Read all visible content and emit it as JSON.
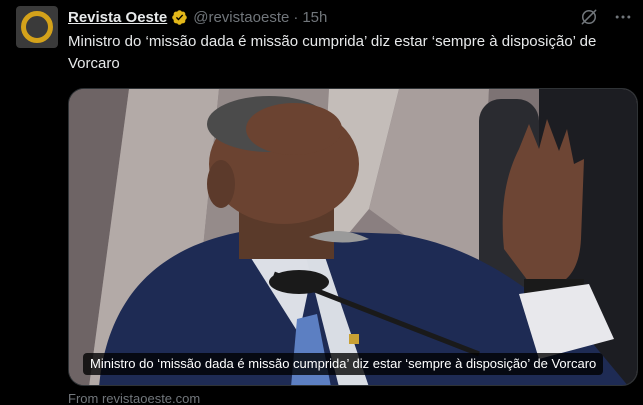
{
  "author": {
    "name": "Revista Oeste",
    "handle": "@revistaoeste",
    "separator": "·",
    "time": "15h",
    "verified_color": "#e2b719"
  },
  "icons": {
    "avatar": "revista-oeste-logo-icon",
    "verified": "verified-badge-icon",
    "grok": "grok-icon",
    "more": "more-options-icon"
  },
  "tweet": {
    "text": "Ministro do ‘missão dada é missão cumprida’ diz estar ‘sempre à disposição’ de Vorcaro"
  },
  "card": {
    "caption": "Ministro do ‘missão dada é missão cumprida’ diz estar ‘sempre à disposição’ de Vorcaro",
    "source": "From revistaoeste.com"
  },
  "colors": {
    "background": "#000000",
    "text": "#e7e9ea",
    "muted": "#71767b",
    "avatar_ring": "#d4a21a"
  }
}
